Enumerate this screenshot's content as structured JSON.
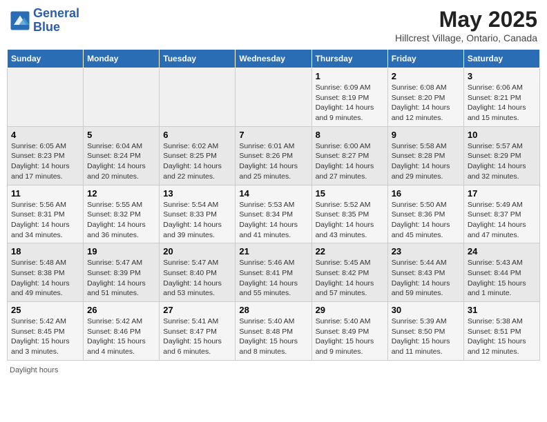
{
  "header": {
    "logo_line1": "General",
    "logo_line2": "Blue",
    "title": "May 2025",
    "subtitle": "Hillcrest Village, Ontario, Canada"
  },
  "columns": [
    "Sunday",
    "Monday",
    "Tuesday",
    "Wednesday",
    "Thursday",
    "Friday",
    "Saturday"
  ],
  "weeks": [
    [
      {
        "day": "",
        "info": ""
      },
      {
        "day": "",
        "info": ""
      },
      {
        "day": "",
        "info": ""
      },
      {
        "day": "",
        "info": ""
      },
      {
        "day": "1",
        "info": "Sunrise: 6:09 AM\nSunset: 8:19 PM\nDaylight: 14 hours\nand 9 minutes."
      },
      {
        "day": "2",
        "info": "Sunrise: 6:08 AM\nSunset: 8:20 PM\nDaylight: 14 hours\nand 12 minutes."
      },
      {
        "day": "3",
        "info": "Sunrise: 6:06 AM\nSunset: 8:21 PM\nDaylight: 14 hours\nand 15 minutes."
      }
    ],
    [
      {
        "day": "4",
        "info": "Sunrise: 6:05 AM\nSunset: 8:23 PM\nDaylight: 14 hours\nand 17 minutes."
      },
      {
        "day": "5",
        "info": "Sunrise: 6:04 AM\nSunset: 8:24 PM\nDaylight: 14 hours\nand 20 minutes."
      },
      {
        "day": "6",
        "info": "Sunrise: 6:02 AM\nSunset: 8:25 PM\nDaylight: 14 hours\nand 22 minutes."
      },
      {
        "day": "7",
        "info": "Sunrise: 6:01 AM\nSunset: 8:26 PM\nDaylight: 14 hours\nand 25 minutes."
      },
      {
        "day": "8",
        "info": "Sunrise: 6:00 AM\nSunset: 8:27 PM\nDaylight: 14 hours\nand 27 minutes."
      },
      {
        "day": "9",
        "info": "Sunrise: 5:58 AM\nSunset: 8:28 PM\nDaylight: 14 hours\nand 29 minutes."
      },
      {
        "day": "10",
        "info": "Sunrise: 5:57 AM\nSunset: 8:29 PM\nDaylight: 14 hours\nand 32 minutes."
      }
    ],
    [
      {
        "day": "11",
        "info": "Sunrise: 5:56 AM\nSunset: 8:31 PM\nDaylight: 14 hours\nand 34 minutes."
      },
      {
        "day": "12",
        "info": "Sunrise: 5:55 AM\nSunset: 8:32 PM\nDaylight: 14 hours\nand 36 minutes."
      },
      {
        "day": "13",
        "info": "Sunrise: 5:54 AM\nSunset: 8:33 PM\nDaylight: 14 hours\nand 39 minutes."
      },
      {
        "day": "14",
        "info": "Sunrise: 5:53 AM\nSunset: 8:34 PM\nDaylight: 14 hours\nand 41 minutes."
      },
      {
        "day": "15",
        "info": "Sunrise: 5:52 AM\nSunset: 8:35 PM\nDaylight: 14 hours\nand 43 minutes."
      },
      {
        "day": "16",
        "info": "Sunrise: 5:50 AM\nSunset: 8:36 PM\nDaylight: 14 hours\nand 45 minutes."
      },
      {
        "day": "17",
        "info": "Sunrise: 5:49 AM\nSunset: 8:37 PM\nDaylight: 14 hours\nand 47 minutes."
      }
    ],
    [
      {
        "day": "18",
        "info": "Sunrise: 5:48 AM\nSunset: 8:38 PM\nDaylight: 14 hours\nand 49 minutes."
      },
      {
        "day": "19",
        "info": "Sunrise: 5:47 AM\nSunset: 8:39 PM\nDaylight: 14 hours\nand 51 minutes."
      },
      {
        "day": "20",
        "info": "Sunrise: 5:47 AM\nSunset: 8:40 PM\nDaylight: 14 hours\nand 53 minutes."
      },
      {
        "day": "21",
        "info": "Sunrise: 5:46 AM\nSunset: 8:41 PM\nDaylight: 14 hours\nand 55 minutes."
      },
      {
        "day": "22",
        "info": "Sunrise: 5:45 AM\nSunset: 8:42 PM\nDaylight: 14 hours\nand 57 minutes."
      },
      {
        "day": "23",
        "info": "Sunrise: 5:44 AM\nSunset: 8:43 PM\nDaylight: 14 hours\nand 59 minutes."
      },
      {
        "day": "24",
        "info": "Sunrise: 5:43 AM\nSunset: 8:44 PM\nDaylight: 15 hours\nand 1 minute."
      }
    ],
    [
      {
        "day": "25",
        "info": "Sunrise: 5:42 AM\nSunset: 8:45 PM\nDaylight: 15 hours\nand 3 minutes."
      },
      {
        "day": "26",
        "info": "Sunrise: 5:42 AM\nSunset: 8:46 PM\nDaylight: 15 hours\nand 4 minutes."
      },
      {
        "day": "27",
        "info": "Sunrise: 5:41 AM\nSunset: 8:47 PM\nDaylight: 15 hours\nand 6 minutes."
      },
      {
        "day": "28",
        "info": "Sunrise: 5:40 AM\nSunset: 8:48 PM\nDaylight: 15 hours\nand 8 minutes."
      },
      {
        "day": "29",
        "info": "Sunrise: 5:40 AM\nSunset: 8:49 PM\nDaylight: 15 hours\nand 9 minutes."
      },
      {
        "day": "30",
        "info": "Sunrise: 5:39 AM\nSunset: 8:50 PM\nDaylight: 15 hours\nand 11 minutes."
      },
      {
        "day": "31",
        "info": "Sunrise: 5:38 AM\nSunset: 8:51 PM\nDaylight: 15 hours\nand 12 minutes."
      }
    ]
  ],
  "footer": {
    "daylight_label": "Daylight hours"
  }
}
